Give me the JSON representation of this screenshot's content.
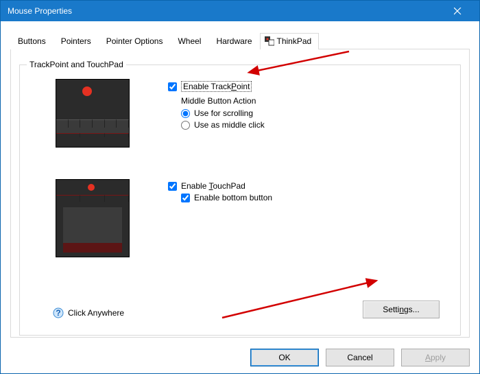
{
  "window": {
    "title": "Mouse Properties"
  },
  "tabs": [
    "Buttons",
    "Pointers",
    "Pointer Options",
    "Wheel",
    "Hardware",
    "ThinkPad"
  ],
  "activeTab": "ThinkPad",
  "group": {
    "title": "TrackPoint and TouchPad",
    "trackpoint": {
      "enable_label_pre": "Enable Track",
      "enable_key": "P",
      "enable_label_post": "oint",
      "middle_heading": "Middle Button Action",
      "radio_scroll": "Use for scrolling",
      "radio_middle": "Use as middle click"
    },
    "touchpad": {
      "enable_label_pre": "Enable ",
      "enable_key": "T",
      "enable_label_post": "ouchPad",
      "bottom_label": "Enable bottom button"
    },
    "click_anywhere": "Click Anywhere",
    "settings_pre": "Setti",
    "settings_key": "n",
    "settings_post": "gs..."
  },
  "buttons": {
    "ok": "OK",
    "cancel": "Cancel",
    "apply_pre": "",
    "apply_key": "A",
    "apply_post": "pply"
  }
}
